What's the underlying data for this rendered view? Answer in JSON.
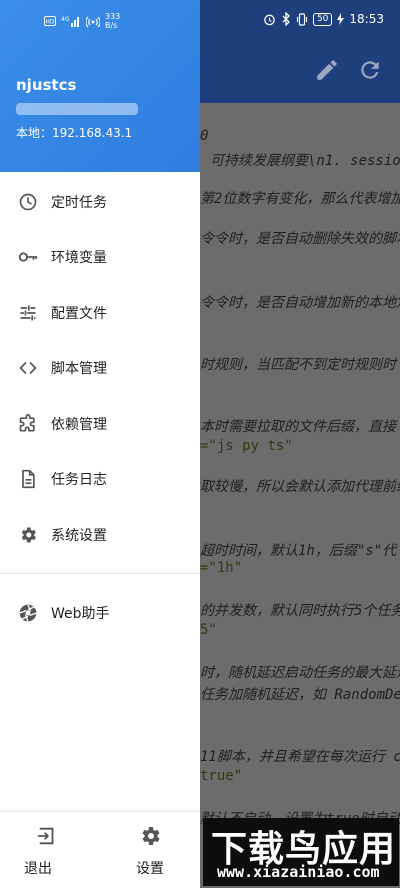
{
  "status_bar": {
    "net_speed_value": "333",
    "net_speed_unit": "B/s",
    "battery": "50",
    "time": "18:53"
  },
  "drawer": {
    "username": "njustcs",
    "ip": "本地：192.168.43.1",
    "menu": [
      {
        "label": "定时任务",
        "icon": "clock-icon"
      },
      {
        "label": "环境变量",
        "icon": "key-icon"
      },
      {
        "label": "配置文件",
        "icon": "sliders-icon"
      },
      {
        "label": "脚本管理",
        "icon": "code-icon"
      },
      {
        "label": "依赖管理",
        "icon": "puzzle-icon"
      },
      {
        "label": "任务日志",
        "icon": "document-icon"
      },
      {
        "label": "系统设置",
        "icon": "gear-icon"
      }
    ],
    "extra": {
      "label": "Web助手",
      "icon": "aperture-icon"
    },
    "bottom": {
      "logout": "退出",
      "settings": "设置"
    }
  },
  "background": {
    "lines": [
      "0",
      "可持续发展纲要\\n1. sessio",
      "第2位数字有变化，那么代表增加",
      "令令时，是否自动删除失效的脚本",
      "令令时，是否自动增加新的本地定",
      "时规则，当匹配不到定时规则时",
      "本时需要拉取的文件后缀，直接",
      "=\"js py ts\"",
      "取较慢，所以会默认添加代理前缀",
      "超时时间，默认1h，后缀\"s\"代",
      "=\"1h\"",
      "的并发数，默认同时执行5个任务",
      "5\"",
      "时，随机延迟启动任务的最大延迟",
      "任务加随机延迟，如 RandomDe",
      "11脚本，并且希望在每次运行 c",
      "true\"",
      "默认不启动，设置为true时自动"
    ]
  },
  "watermark": {
    "main": "下载鸟应用",
    "sub": "www.xiazainiao.com"
  }
}
